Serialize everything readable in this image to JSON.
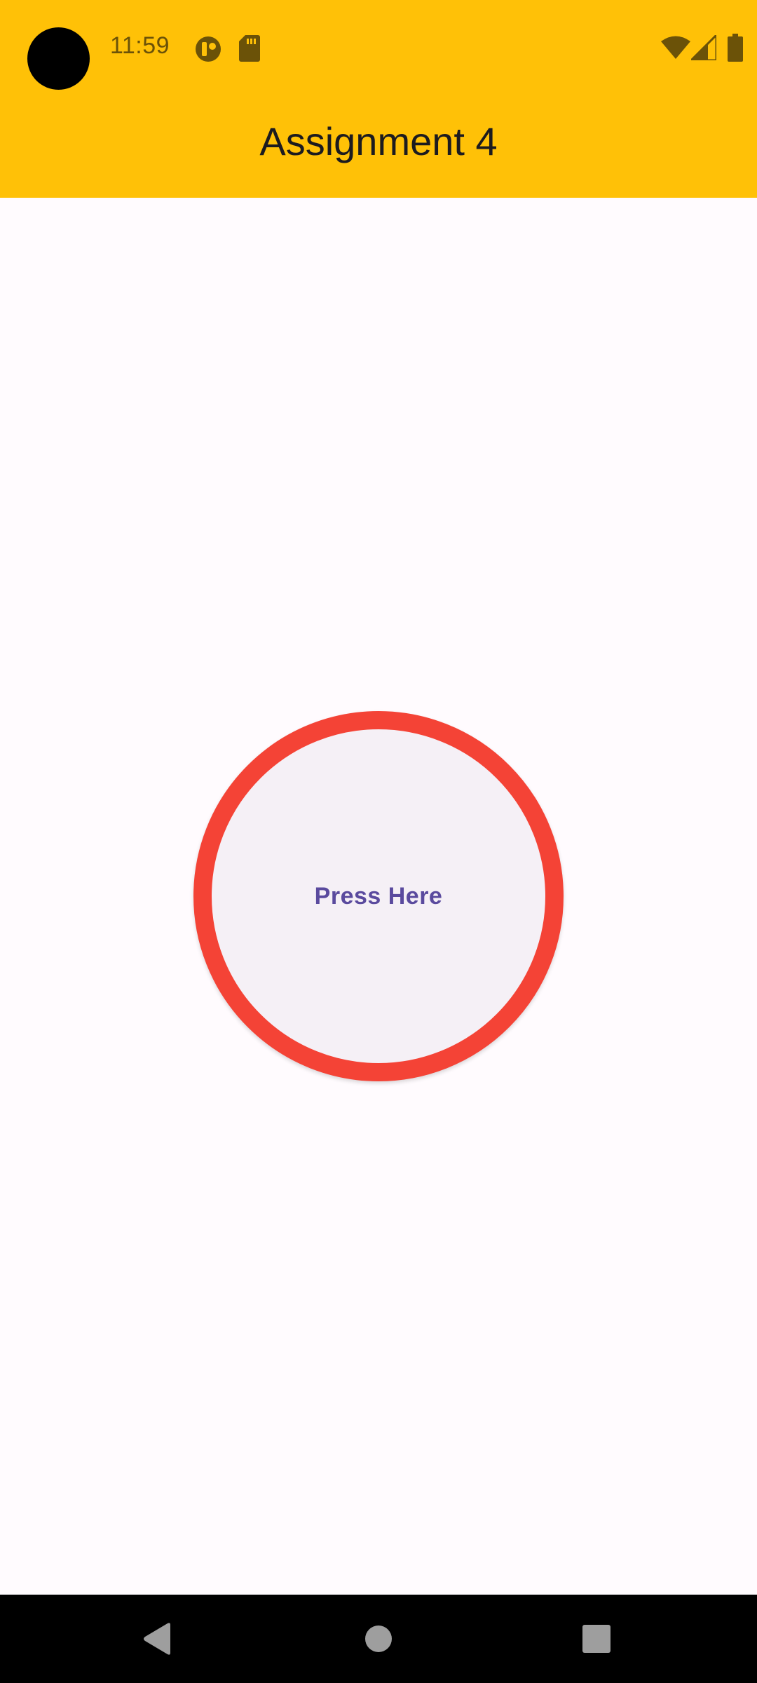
{
  "status_bar": {
    "time": "11:59",
    "icons": [
      "app-notification-icon",
      "sd-card-icon",
      "wifi-icon",
      "cell-signal-icon",
      "battery-icon"
    ]
  },
  "app_bar": {
    "title": "Assignment 4",
    "background_color": "#FFC107"
  },
  "main": {
    "button_label": "Press Here",
    "button_border_color": "#F44336",
    "button_fill_color": "#F5F0F6",
    "button_text_color": "#5A4A9E"
  },
  "nav_bar": {
    "buttons": [
      "back-icon",
      "home-icon",
      "recents-icon"
    ]
  }
}
